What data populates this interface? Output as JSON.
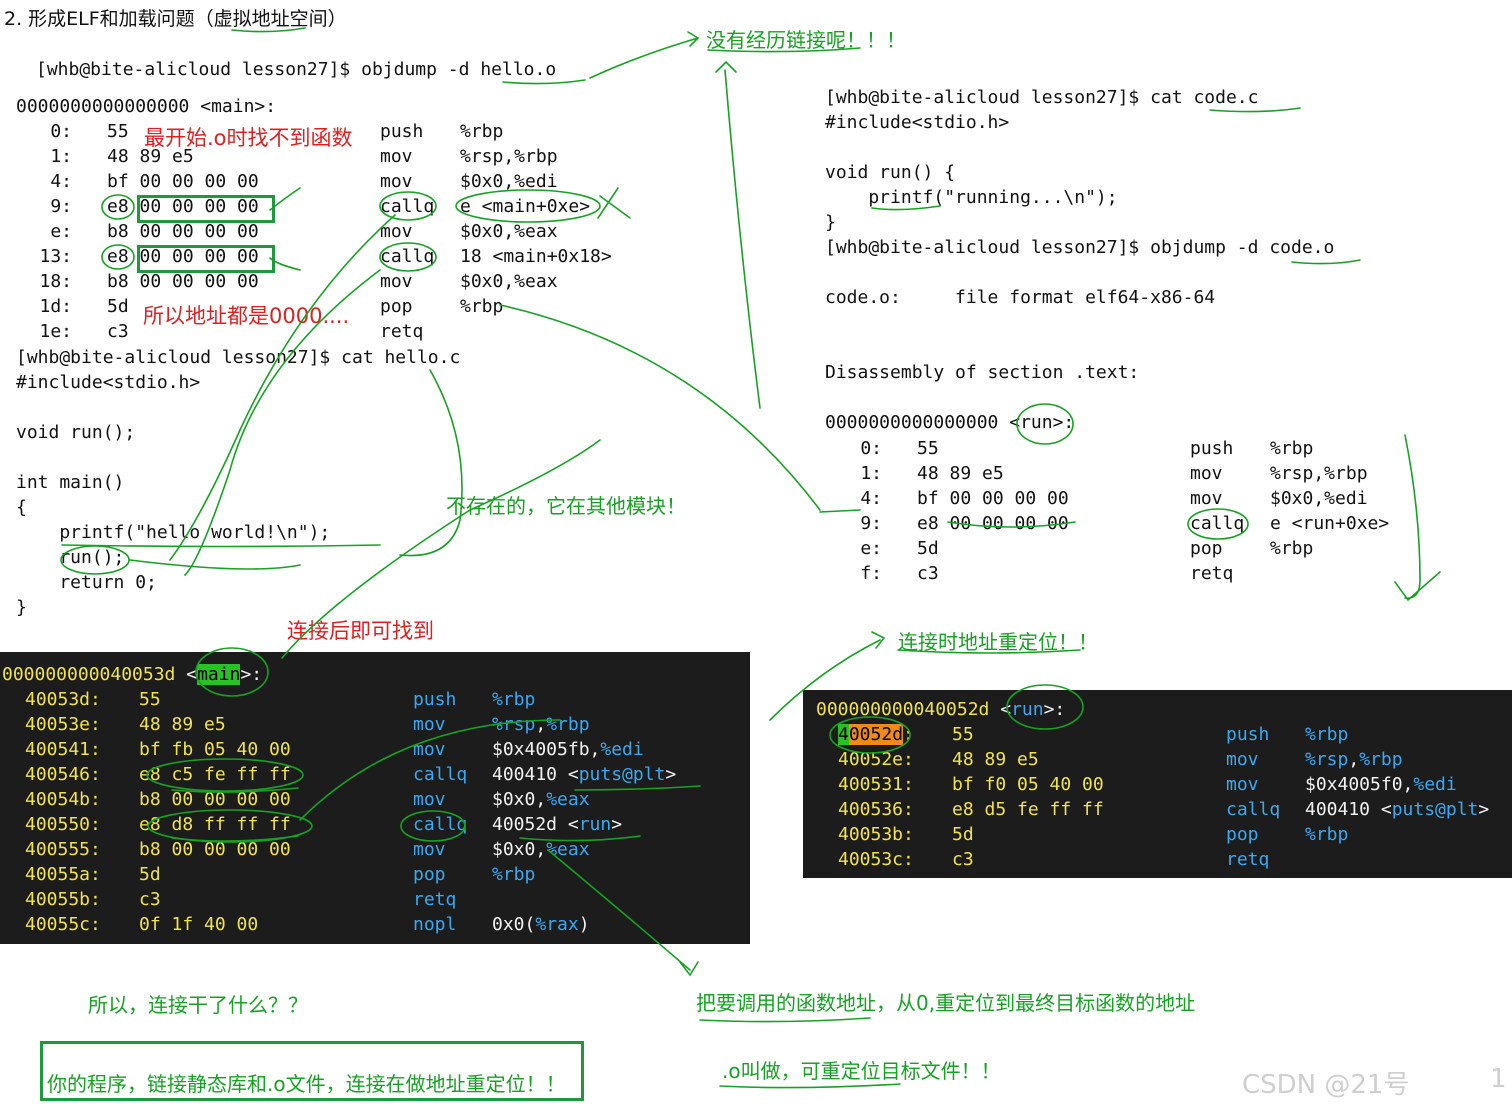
{
  "title": "2. 形成ELF和加载问题（虚拟地址空间）",
  "left_panel": {
    "cmd": "[whb@bite-alicloud lesson27]$ objdump -d hello.o",
    "header": "0000000000000000 <main>:",
    "rows": [
      {
        "addr": "0:",
        "bytes": "55",
        "op": "push",
        "arg": "%rbp"
      },
      {
        "addr": "1:",
        "bytes": "48 89 e5",
        "op": "mov",
        "arg": "%rsp,%rbp"
      },
      {
        "addr": "4:",
        "bytes": "bf 00 00 00 00",
        "op": "mov",
        "arg": "$0x0,%edi"
      },
      {
        "addr": "9:",
        "bytes": "e8 00 00 00 00",
        "op": "callq",
        "arg": "e <main+0xe>"
      },
      {
        "addr": "e:",
        "bytes": "b8 00 00 00 00",
        "op": "mov",
        "arg": "$0x0,%eax"
      },
      {
        "addr": "13:",
        "bytes": "e8 00 00 00 00",
        "op": "callq",
        "arg": "18 <main+0x18>"
      },
      {
        "addr": "18:",
        "bytes": "b8 00 00 00 00",
        "op": "mov",
        "arg": "$0x0,%eax"
      },
      {
        "addr": "1d:",
        "bytes": "5d",
        "op": "pop",
        "arg": "%rbp"
      },
      {
        "addr": "1e:",
        "bytes": "c3",
        "op": "retq",
        "arg": ""
      }
    ],
    "source_lines": [
      "[whb@bite-alicloud lesson27]$ cat hello.c",
      "#include<stdio.h>",
      "",
      "void run();",
      "",
      "int main()",
      "{",
      "    printf(\"hello world!\\n\");",
      "    run();",
      "    return 0;",
      "}"
    ]
  },
  "right_panel": {
    "lines": [
      "[whb@bite-alicloud lesson27]$ cat code.c",
      "#include<stdio.h>",
      "",
      "void run() {",
      "    printf(\"running...\\n\");",
      "}",
      "[whb@bite-alicloud lesson27]$ objdump -d code.o",
      "",
      "code.o:     file format elf64-x86-64",
      "",
      "",
      "Disassembly of section .text:",
      "",
      "0000000000000000 <run>:"
    ],
    "rows": [
      {
        "addr": "0:",
        "bytes": "55",
        "op": "push",
        "arg": "%rbp"
      },
      {
        "addr": "1:",
        "bytes": "48 89 e5",
        "op": "mov",
        "arg": "%rsp,%rbp"
      },
      {
        "addr": "4:",
        "bytes": "bf 00 00 00 00",
        "op": "mov",
        "arg": "$0x0,%edi"
      },
      {
        "addr": "9:",
        "bytes": "e8 00 00 00 00",
        "op": "callq",
        "arg": "e <run+0xe>"
      },
      {
        "addr": "e:",
        "bytes": "5d",
        "op": "pop",
        "arg": "%rbp"
      },
      {
        "addr": "f:",
        "bytes": "c3",
        "op": "retq",
        "arg": ""
      }
    ]
  },
  "term_main": {
    "header_num": "000000000040053d",
    "header_pre": " <",
    "header_sym": "main",
    "header_post": ">:",
    "rows": [
      {
        "addr": "40053d:",
        "bytes": "55",
        "op": "push",
        "arg": "%rbp"
      },
      {
        "addr": "40053e:",
        "bytes": "48 89 e5",
        "op": "mov",
        "arg": "%rsp,%rbp"
      },
      {
        "addr": "400541:",
        "bytes": "bf fb 05 40 00",
        "op": "mov",
        "arg": "$0x4005fb,%edi"
      },
      {
        "addr": "400546:",
        "bytes": "e8 c5 fe ff ff",
        "op": "callq",
        "arg": "400410 <puts@plt>"
      },
      {
        "addr": "40054b:",
        "bytes": "b8 00 00 00 00",
        "op": "mov",
        "arg": "$0x0,%eax"
      },
      {
        "addr": "400550:",
        "bytes": "e8 d8 ff ff ff",
        "op": "callq",
        "arg": "40052d <run>"
      },
      {
        "addr": "400555:",
        "bytes": "b8 00 00 00 00",
        "op": "mov",
        "arg": "$0x0,%eax"
      },
      {
        "addr": "40055a:",
        "bytes": "5d",
        "op": "pop",
        "arg": "%rbp"
      },
      {
        "addr": "40055b:",
        "bytes": "c3",
        "op": "retq",
        "arg": ""
      },
      {
        "addr": "40055c:",
        "bytes": "0f 1f 40 00",
        "op": "nopl",
        "arg": "0x0(%rax)"
      }
    ]
  },
  "term_run": {
    "header_num": "000000000040052d",
    "header_rest": " <run>:",
    "first_addr": "40052d",
    "rows": [
      {
        "addr": "40052d:",
        "bytes": "55",
        "op": "push",
        "arg": "%rbp"
      },
      {
        "addr": "40052e:",
        "bytes": "48 89 e5",
        "op": "mov",
        "arg": "%rsp,%rbp"
      },
      {
        "addr": "400531:",
        "bytes": "bf f0 05 40 00",
        "op": "mov",
        "arg": "$0x4005f0,%edi"
      },
      {
        "addr": "400536:",
        "bytes": "e8 d5 fe ff ff",
        "op": "callq",
        "arg": "400410 <puts@plt>"
      },
      {
        "addr": "40053b:",
        "bytes": "5d",
        "op": "pop",
        "arg": "%rbp"
      },
      {
        "addr": "40053c:",
        "bytes": "c3",
        "op": "retq",
        "arg": ""
      }
    ]
  },
  "notes": {
    "not_linked": "没有经历链接呢！！！",
    "cannot_find": "最开始.o时找不到函数",
    "address_zero": "所以地址都是0000....",
    "other_module": "不存在的，它在其他模块！",
    "found_after": "连接后即可找到",
    "relocate": "连接时地址重定位！！",
    "what_link": "所以，连接干了什么？？",
    "explain": "把要调用的函数地址，从0,重定位到最终目标函数的地址",
    "summary": "你的程序，链接静态库和.o文件，连接在做地址重定位！！",
    "relocatable": ".o叫做，可重定位目标文件！！"
  },
  "watermark": "CSDN @21号",
  "corner_num": "1",
  "colors": {
    "terminal_bg": "#1c1c1c",
    "term_yellow": "#f1e34a",
    "term_blue": "#39a9f2",
    "annotation_green": "#16a323",
    "annotation_red": "#e02020",
    "box_green": "#1e9a3c",
    "highlight_orange": "#f08a18",
    "highlight_green": "#27c224"
  }
}
